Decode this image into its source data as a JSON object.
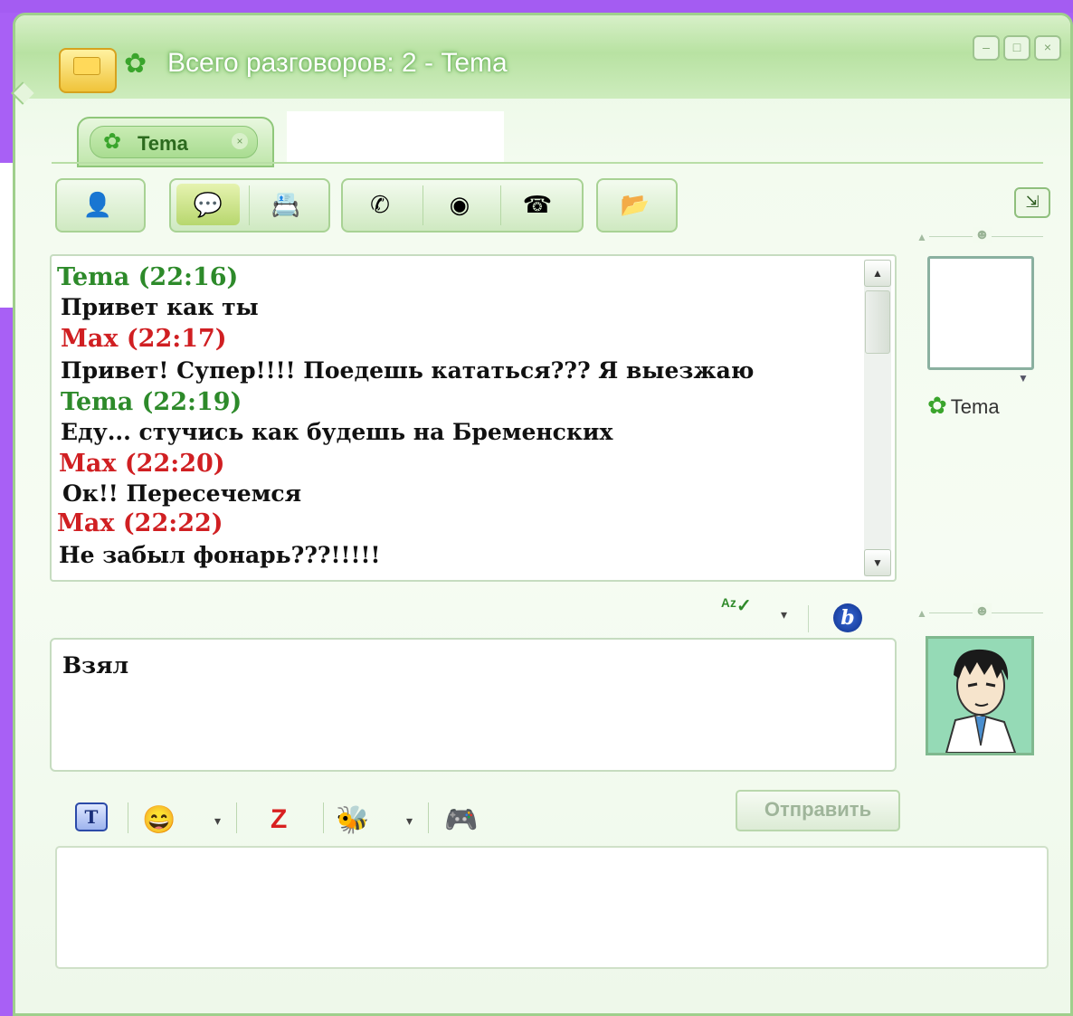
{
  "window": {
    "title": "Всего разговоров: 2 - Tema",
    "controls": [
      "minimize",
      "maximize",
      "close"
    ]
  },
  "tabs": [
    {
      "label": "Tema",
      "icon": "flower-icon"
    }
  ],
  "toolbar": {
    "buttons": [
      "add-contact-icon",
      "chat-icon",
      "files-icon",
      "phone-icon",
      "webcam-icon",
      "fax-icon",
      "send-file-icon"
    ]
  },
  "chat": {
    "messages": [
      {
        "sender": "Tema",
        "time": "(22:16)",
        "header": "Tema (22:16)",
        "text": "Привет как ты",
        "color": "#2d8a2a"
      },
      {
        "sender": "Max",
        "time": "(22:17)",
        "header": "Max (22:17)",
        "text": "Привет! Супер!!!! Поедешь кататься??? Я выезжаю",
        "color": "#d01f22"
      },
      {
        "sender": "Tema",
        "time": "(22:19)",
        "header": "Tema (22:19)",
        "text": "Еду... стучись как будешь на Бременских",
        "color": "#2d8a2a"
      },
      {
        "sender": "Max",
        "time": "(22:20)",
        "header": "Max (22:20)",
        "text": "Ок!! Пересечемся",
        "color": "#d01f22"
      },
      {
        "sender": "Max",
        "time": "(22:22)",
        "header": "Max (22:22)",
        "text": "Не забыл фонарь???!!!!!",
        "color": "#d01f22"
      }
    ]
  },
  "contact": {
    "name": "Tema"
  },
  "input": {
    "value": "Взял"
  },
  "send_button": {
    "label": "Отправить"
  },
  "colors": {
    "accent": "#9fcf8c",
    "background_frame": "#a860f5"
  }
}
